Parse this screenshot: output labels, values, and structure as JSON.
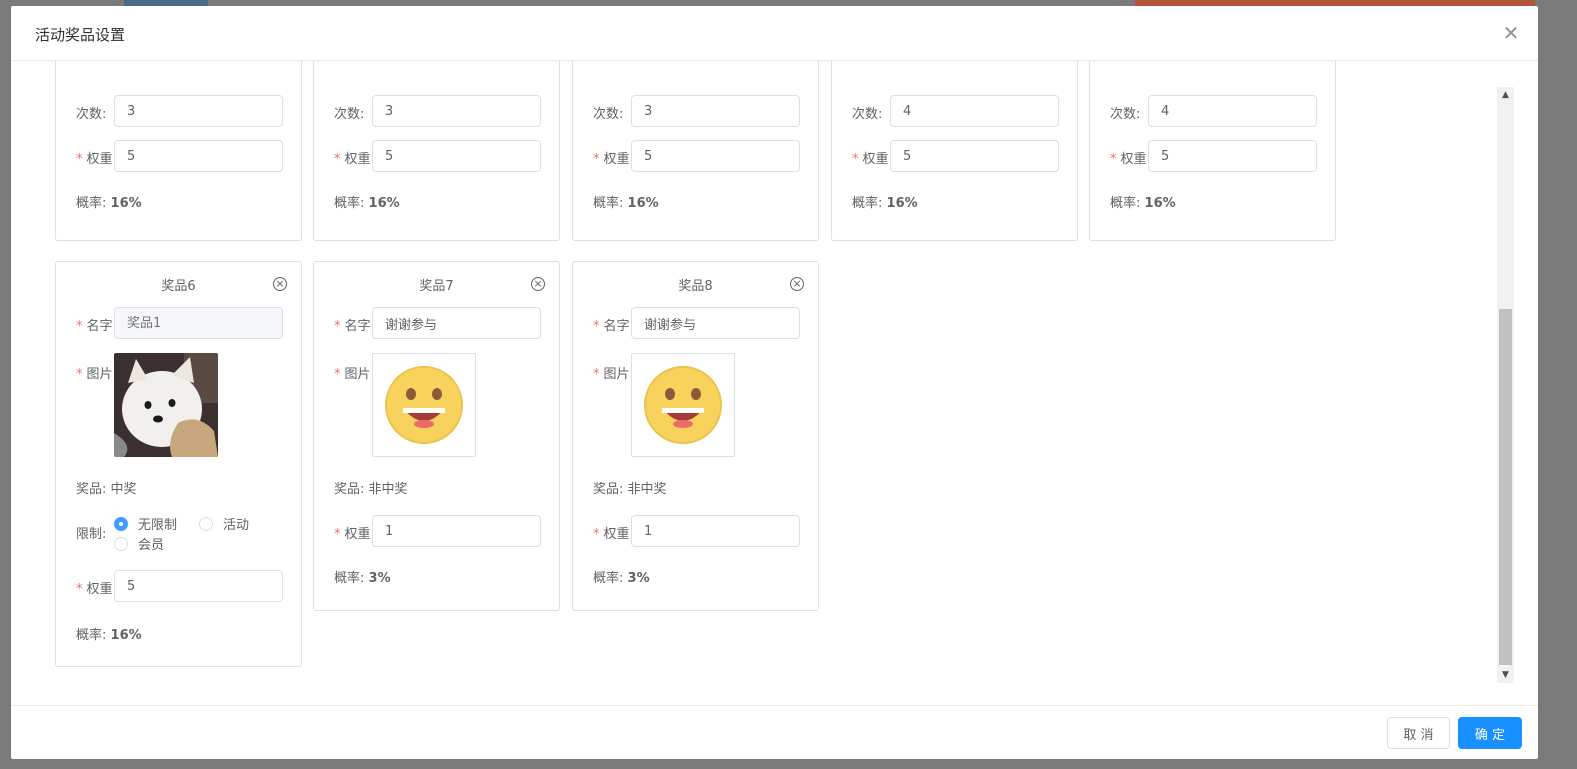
{
  "modal": {
    "title": "活动奖品设置"
  },
  "labels": {
    "count": "次数:",
    "weight": "权重",
    "name": "名字",
    "image": "图片",
    "prize": "奖品:",
    "limit": "限制:",
    "prob": "概率:"
  },
  "top_cards": [
    {
      "count": "3",
      "weight": "5",
      "prob": "16%"
    },
    {
      "count": "3",
      "weight": "5",
      "prob": "16%"
    },
    {
      "count": "3",
      "weight": "5",
      "prob": "16%"
    },
    {
      "count": "4",
      "weight": "5",
      "prob": "16%"
    },
    {
      "count": "4",
      "weight": "5",
      "prob": "16%"
    }
  ],
  "cards": [
    {
      "title": "奖品6",
      "name_placeholder": "奖品1",
      "image": "dog-photo",
      "prize_type": "中奖",
      "limit_options": [
        "无限制",
        "活动",
        "会员"
      ],
      "limit_selected": "无限制",
      "weight": "5",
      "prob": "16%"
    },
    {
      "title": "奖品7",
      "name": "谢谢参与",
      "image": "smiley-icon",
      "prize_type": "非中奖",
      "weight": "1",
      "prob": "3%"
    },
    {
      "title": "奖品8",
      "name": "谢谢参与",
      "image": "smiley-icon",
      "prize_type": "非中奖",
      "weight": "1",
      "prob": "3%"
    }
  ],
  "footer": {
    "cancel": "取 消",
    "confirm": "确 定"
  },
  "colors": {
    "primary": "#1890ff",
    "required": "#f56c6c",
    "border": "#dcdfe6"
  }
}
